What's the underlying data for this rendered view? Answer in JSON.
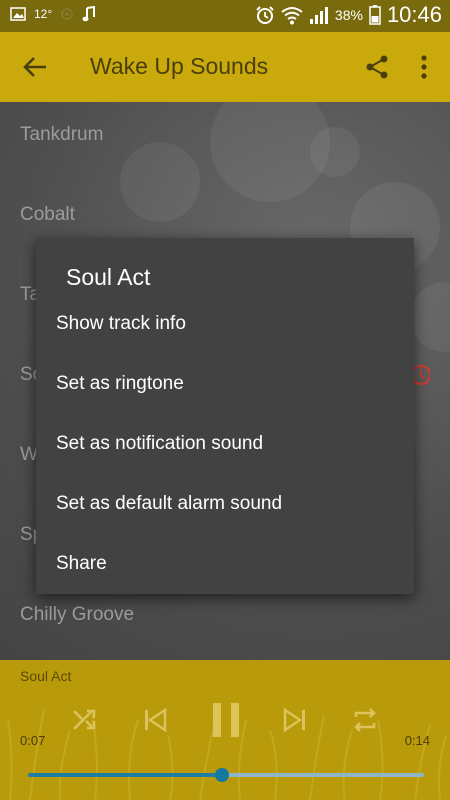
{
  "status_bar": {
    "temperature": "12°",
    "battery_percent": "38%",
    "time": "10:46",
    "icons": [
      "gallery-icon",
      "location-icon",
      "music-note-icon",
      "alarm-icon",
      "wifi-icon",
      "signal-icon",
      "battery-icon"
    ]
  },
  "app_bar": {
    "title": "Wake Up Sounds",
    "back_icon": "arrow-back-icon",
    "share_icon": "share-icon",
    "more_icon": "more-vert-icon"
  },
  "tracks": [
    "Tankdrum",
    "Cobalt",
    "Ta",
    "So",
    "W",
    "Sp",
    "Chilly Groove"
  ],
  "dialog": {
    "title": "Soul Act",
    "options": [
      "Show track info",
      "Set as ringtone",
      "Set as notification sound",
      "Set as default alarm sound",
      "Share"
    ]
  },
  "player": {
    "now_playing": "Soul Act",
    "elapsed": "0:07",
    "total": "0:14",
    "progress": 0.49,
    "controls": [
      "shuffle-icon",
      "skip-previous-icon",
      "pause-icon",
      "skip-next-icon",
      "repeat-icon"
    ]
  },
  "colors": {
    "app_bar": "#c9a90c",
    "status_bar": "#7a6a0e",
    "dialog": "#424242",
    "player": "#b89a0b",
    "progress": "#1c7ea6",
    "alert_accent": "#d9382a"
  }
}
